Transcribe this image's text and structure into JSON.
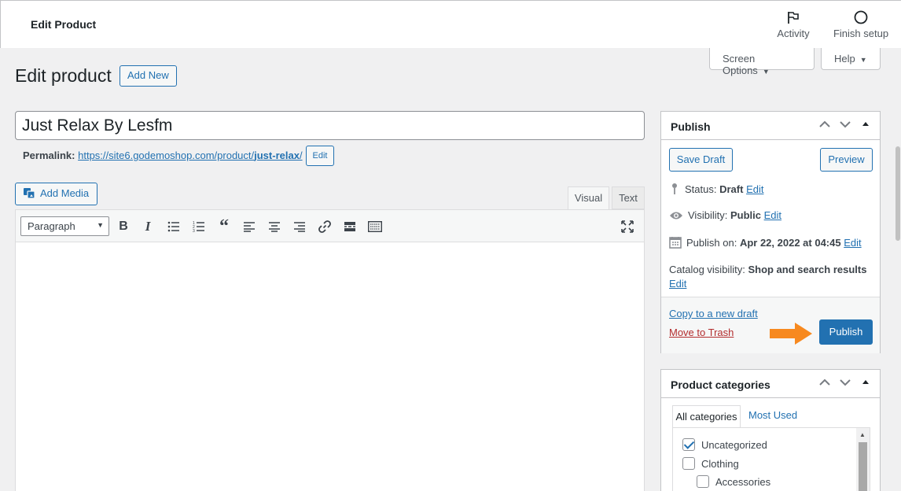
{
  "topbar": {
    "title": "Edit Product",
    "activity_label": "Activity",
    "finish_label": "Finish setup"
  },
  "screen_options": {
    "label": "Screen Options",
    "help": "Help"
  },
  "page": {
    "title": "Edit product",
    "add_new": "Add New"
  },
  "product": {
    "title": "Just Relax By Lesfm",
    "permalink_label": "Permalink:",
    "permalink_base": "https://site6.godemoshop.com/product/",
    "permalink_slug": "just-relax",
    "permalink_end": "/",
    "permalink_edit": "Edit"
  },
  "editor": {
    "add_media": "Add Media",
    "tab_visual": "Visual",
    "tab_text": "Text",
    "format": "Paragraph",
    "tools": [
      "bold-icon",
      "italic-icon",
      "bulleted-list-icon",
      "numbered-list-icon",
      "blockquote-icon",
      "align-left-icon",
      "align-center-icon",
      "align-right-icon",
      "link-icon",
      "read-more-icon",
      "toolbar-toggle-icon",
      "fullscreen-icon"
    ]
  },
  "publish": {
    "title": "Publish",
    "save_draft": "Save Draft",
    "preview": "Preview",
    "status_label": "Status:",
    "status_value": "Draft",
    "visibility_label": "Visibility:",
    "visibility_value": "Public",
    "publish_on_label": "Publish on:",
    "publish_on_value": "Apr 22, 2022 at 04:45",
    "catalog_label": "Catalog visibility:",
    "catalog_value": "Shop and search results",
    "edit": "Edit",
    "copy_draft": "Copy to a new draft",
    "trash": "Move to Trash",
    "publish_btn": "Publish",
    "arrow_color": "#f7891f"
  },
  "categories": {
    "title": "Product categories",
    "tab_all": "All categories",
    "tab_most": "Most Used",
    "items": [
      {
        "label": "Uncategorized",
        "checked": true
      },
      {
        "label": "Clothing",
        "checked": false
      },
      {
        "label": "Accessories",
        "checked": false
      }
    ]
  },
  "colors": {
    "accent": "#2271b1",
    "danger": "#b32d2e",
    "background": "#f0f0f1"
  }
}
